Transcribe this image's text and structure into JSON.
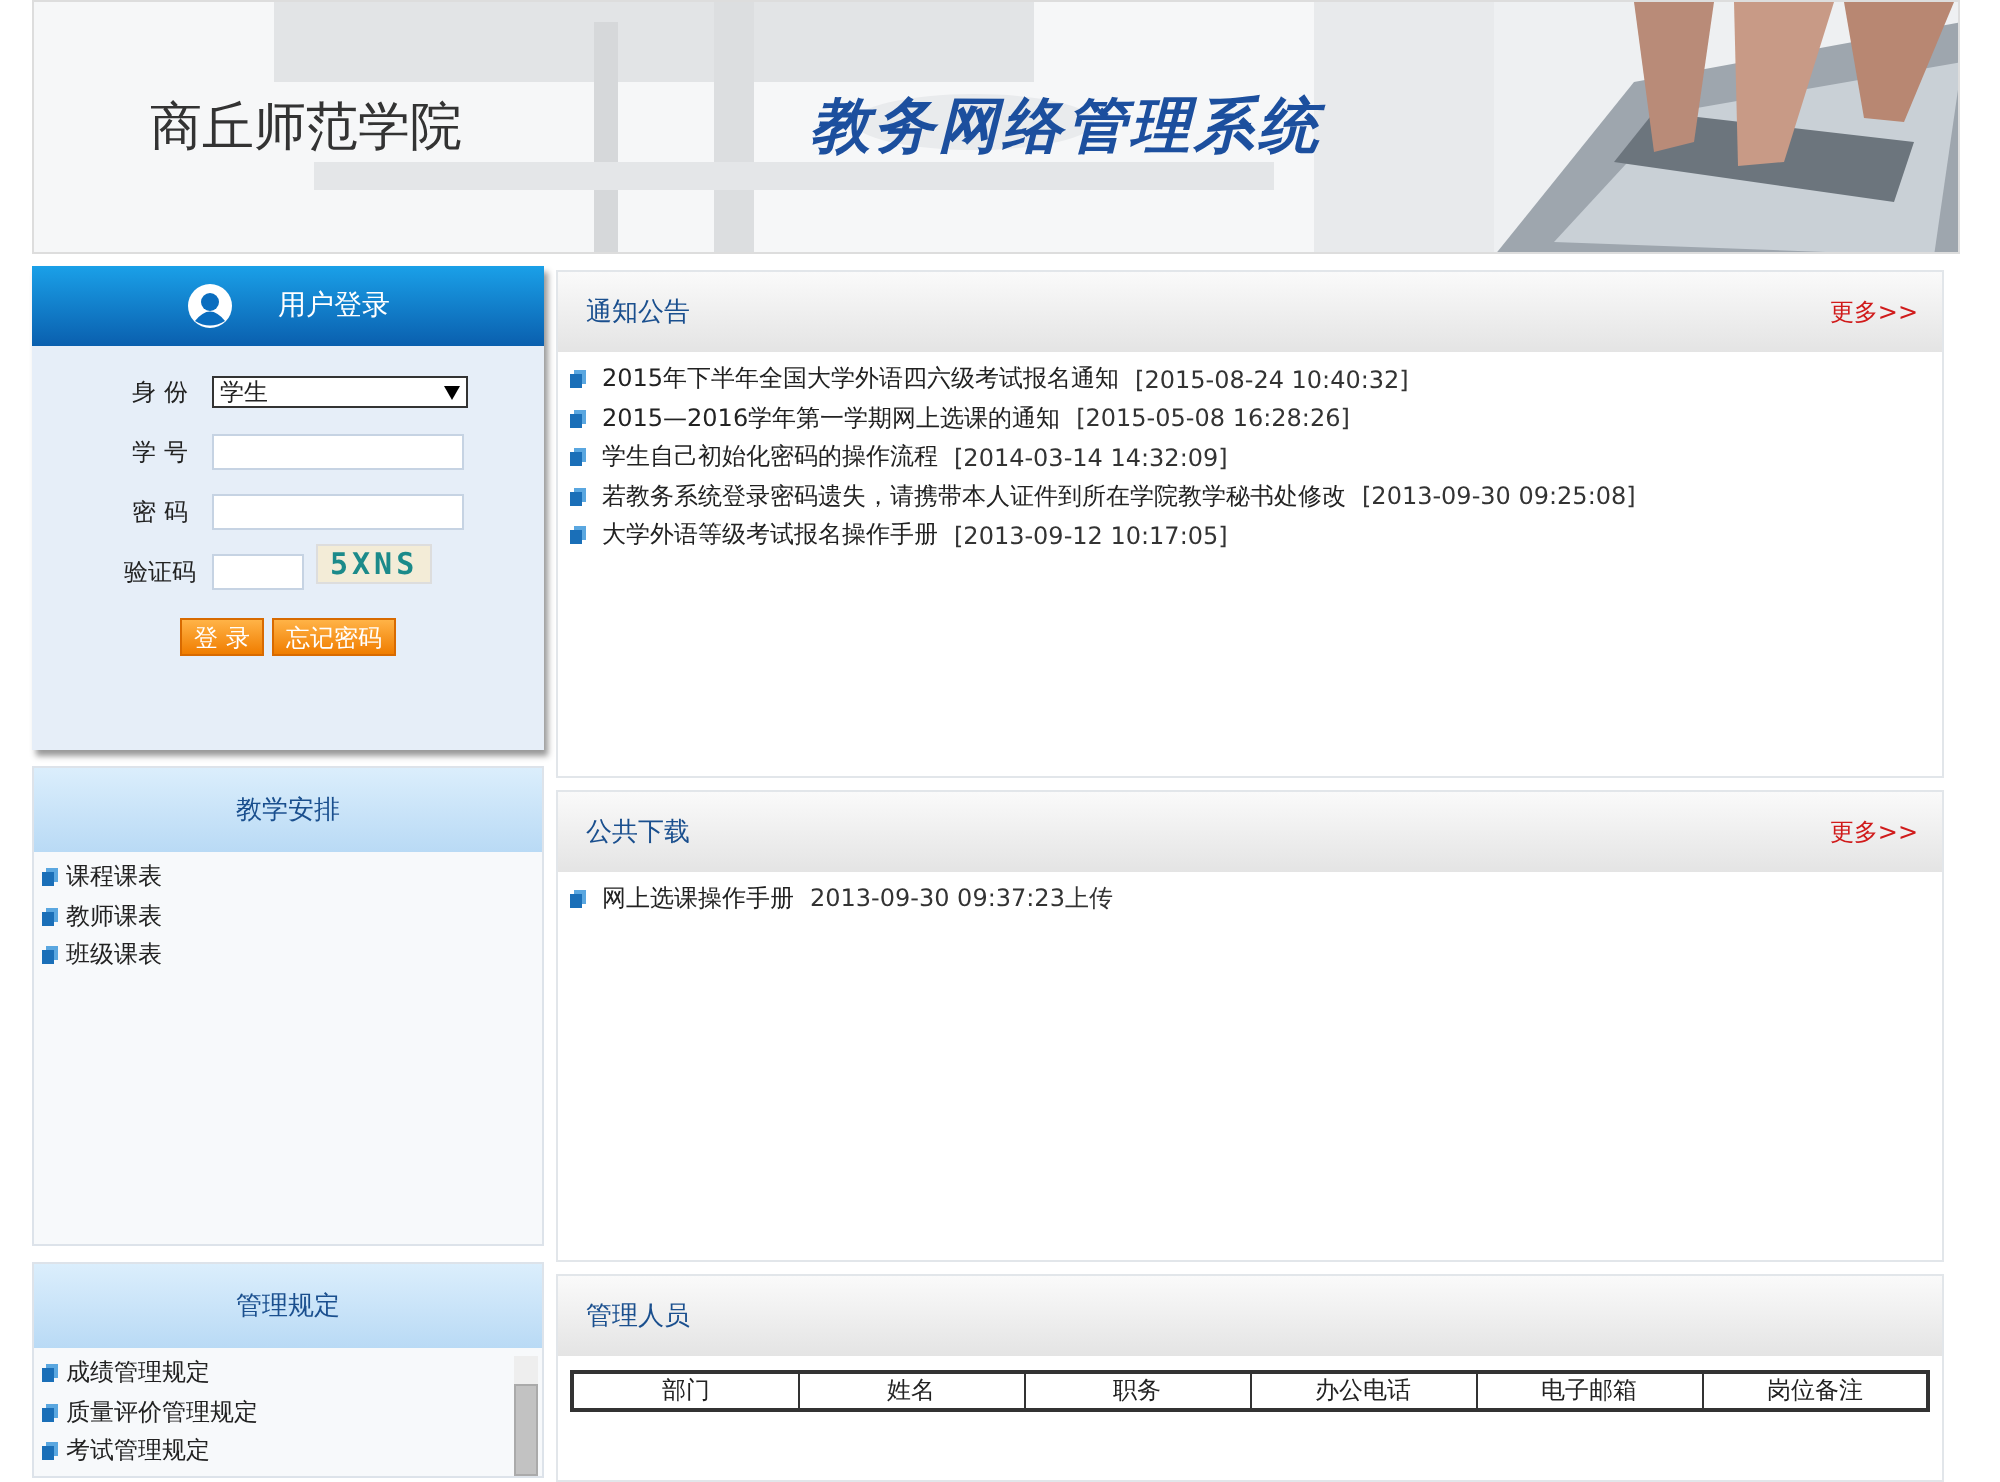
{
  "header": {
    "school": "商丘师范学院",
    "system": "教务网络管理系统"
  },
  "login": {
    "title": "用户登录",
    "fields": [
      {
        "kind": "select",
        "label": "身 份",
        "value": "学生"
      },
      {
        "kind": "text",
        "label": "学 号"
      },
      {
        "kind": "password",
        "label": "密 码"
      },
      {
        "kind": "captcha",
        "label": "验证码",
        "captcha": "5XNS"
      }
    ],
    "buttons": [
      "登 录",
      "忘记密码"
    ]
  },
  "teaching": {
    "title": "教学安排",
    "items": [
      "课程课表",
      "教师课表",
      "班级课表"
    ]
  },
  "rules": {
    "title": "管理规定",
    "items": [
      "成绩管理规定",
      "质量评价管理规定",
      "考试管理规定"
    ]
  },
  "notices": {
    "title": "通知公告",
    "more": "更多>>",
    "items": [
      {
        "text": "2015年下半年全国大学外语四六级考试报名通知",
        "date": "[2015-08-24 10:40:32]"
      },
      {
        "text": "2015—2016学年第一学期网上选课的通知",
        "date": "[2015-05-08 16:28:26]"
      },
      {
        "text": "学生自己初始化密码的操作流程",
        "date": "[2014-03-14 14:32:09]"
      },
      {
        "text": "若教务系统登录密码遗失，请携带本人证件到所在学院教学秘书处修改",
        "date": "[2013-09-30 09:25:08]"
      },
      {
        "text": "大学外语等级考试报名操作手册",
        "date": "[2013-09-12 10:17:05]"
      }
    ]
  },
  "downloads": {
    "title": "公共下载",
    "more": "更多>>",
    "items": [
      {
        "text": "网上选课操作手册",
        "date": "2013-09-30 09:37:23上传"
      }
    ]
  },
  "staff": {
    "title": "管理人员",
    "columns": [
      "部门",
      "姓名",
      "职务",
      "办公电话",
      "电子邮箱",
      "岗位备注"
    ]
  }
}
